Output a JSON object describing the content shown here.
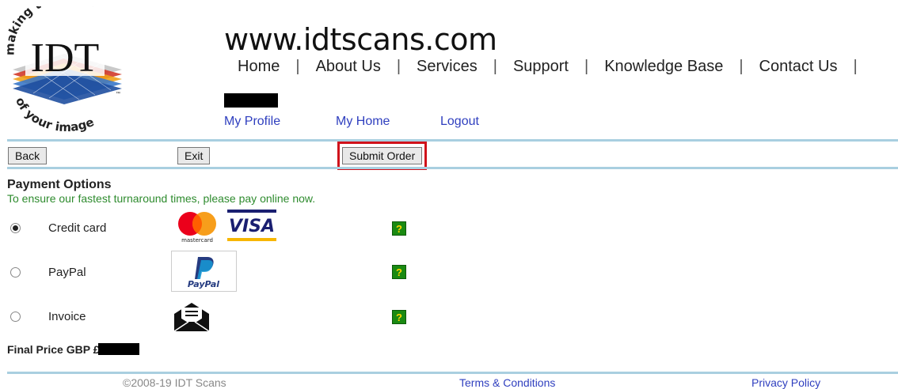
{
  "logo": {
    "arc_top": "making the most",
    "arc_bottom": "of your image",
    "trademark": "™",
    "brand": "IDT"
  },
  "header": {
    "site_title": "www.idtscans.com"
  },
  "nav": [
    "Home",
    "About Us",
    "Services",
    "Support",
    "Knowledge Base",
    "Contact Us"
  ],
  "user_links": {
    "profile": "My Profile",
    "home": "My Home",
    "logout": "Logout"
  },
  "toolbar": {
    "back": "Back",
    "exit": "Exit",
    "submit": "Submit Order"
  },
  "payment": {
    "title": "Payment Options",
    "subtitle": "To ensure our fastest turnaround times, please pay online now.",
    "options": [
      {
        "label": "Credit card",
        "selected": true,
        "icons": [
          "mastercard-icon",
          "visa-icon"
        ],
        "help": "?"
      },
      {
        "label": "PayPal",
        "selected": false,
        "icons": [
          "paypal-icon"
        ],
        "help": "?"
      },
      {
        "label": "Invoice",
        "selected": false,
        "icons": [
          "envelope-icon"
        ],
        "help": "?"
      }
    ]
  },
  "cards": {
    "mastercard_text": "mastercard",
    "visa_text": "VISA",
    "paypal_text": "PayPal"
  },
  "final_price_label": "Final Price GBP £",
  "footer": {
    "copyright": "©2008-19 IDT Scans",
    "terms": "Terms & Conditions",
    "privacy": "Privacy Policy"
  },
  "colors": {
    "accent_rule": "#a9cfe0",
    "link": "#2f3fbf",
    "subtitle_green": "#2e8b2e",
    "help_green": "#1a8a12",
    "highlight_red": "#d0121b"
  }
}
